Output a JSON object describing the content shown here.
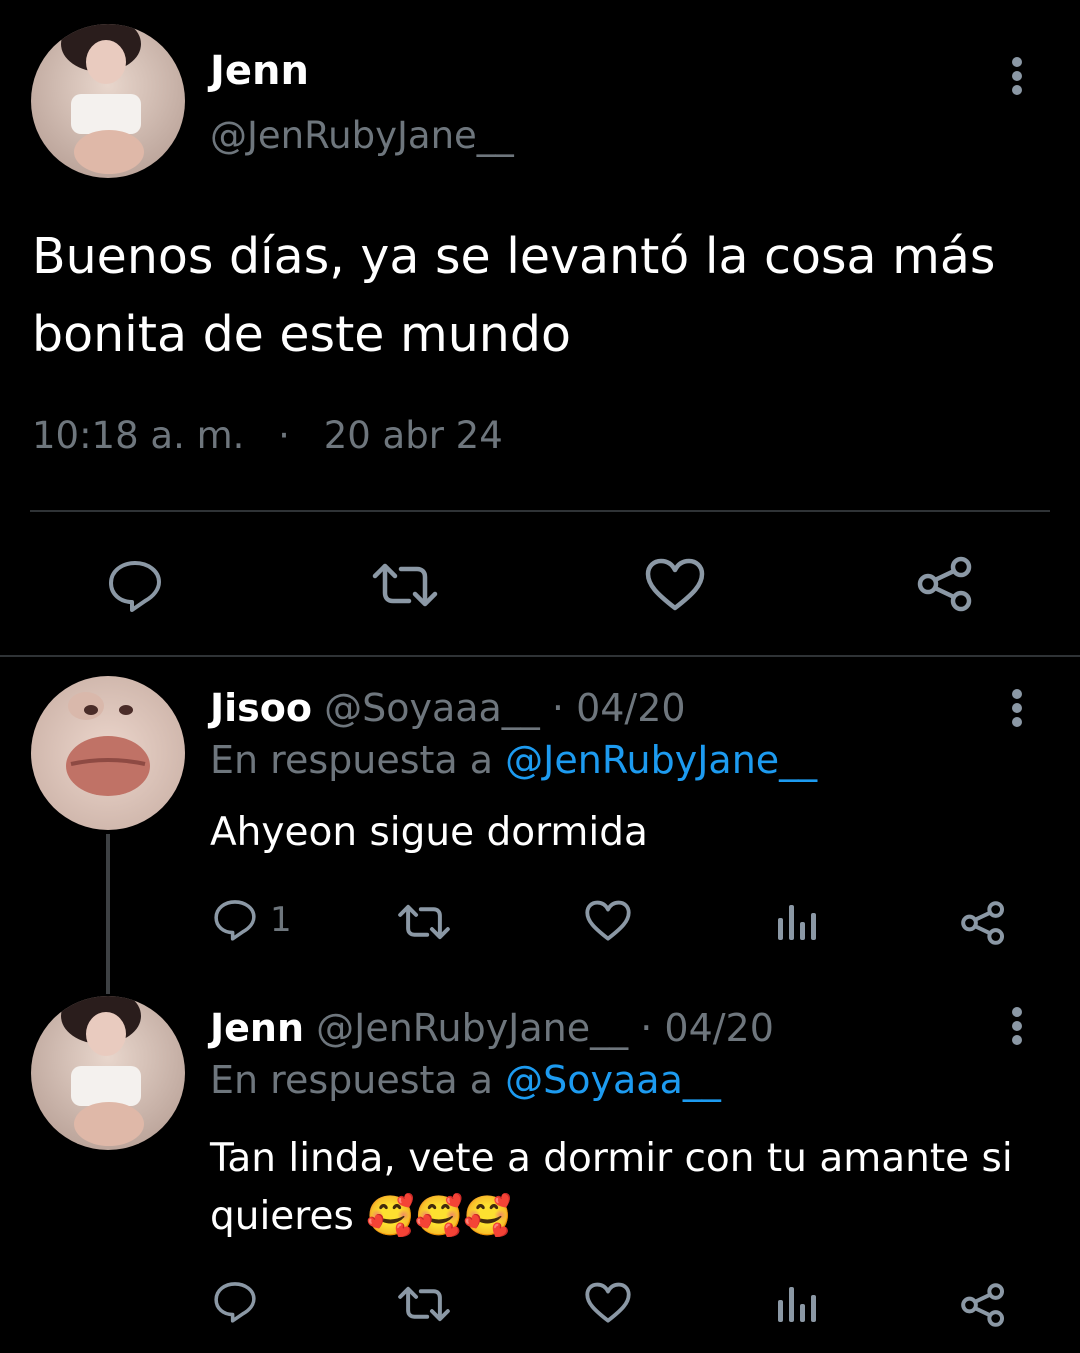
{
  "main_tweet": {
    "display_name": "Jenn",
    "handle": "@JenRubyJane__",
    "text_line1": "Buenos días, ya se levantó la cosa más",
    "text_line2": "bonita de este mundo",
    "time": "10:18 a. m.",
    "separator": "·",
    "date": "20 abr 24"
  },
  "replies": [
    {
      "display_name": "Jisoo",
      "handle": "@Soyaaa__",
      "date": "· 04/20",
      "reply_prefix": "En respuesta a ",
      "reply_to": "@JenRubyJane__",
      "text_line1": "Ahyeon sigue dormida",
      "reply_count": "1"
    },
    {
      "display_name": "Jenn",
      "handle": "@JenRubyJane__",
      "date": "· 04/20",
      "reply_prefix": "En respuesta a ",
      "reply_to": "@Soyaaa__",
      "text_line1": "Tan linda, vete a dormir con tu amante si",
      "text_line2": "quieres 🥰🥰🥰",
      "reply_count": ""
    }
  ],
  "icons": [
    "reply-icon",
    "retweet-icon",
    "like-icon",
    "share-icon",
    "views-icon",
    "more-icon"
  ],
  "colors": {
    "background": "#000000",
    "text": "#e7e9ea",
    "muted": "#6e767d",
    "link": "#1d9bf0",
    "divider": "#2f3336",
    "icon": "#8b98a5"
  }
}
